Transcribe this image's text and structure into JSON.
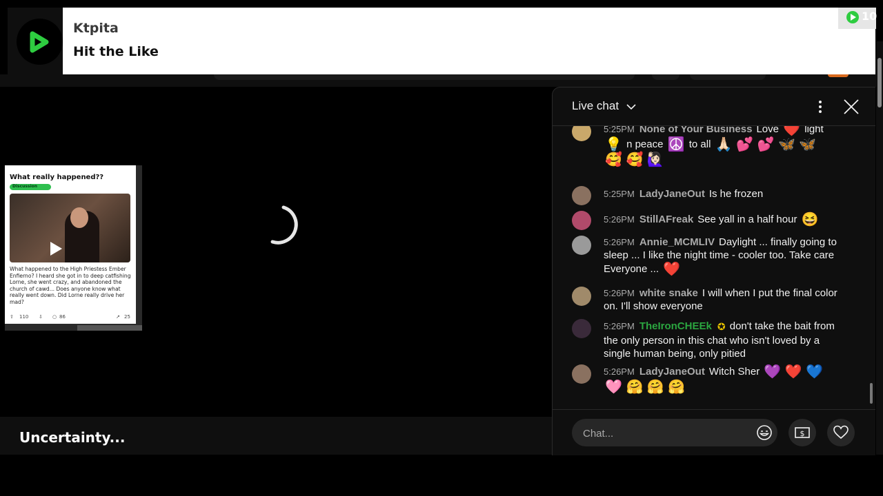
{
  "banner": {
    "title": "Ktpita",
    "subtitle": "Hit the Like",
    "corner_count": "10",
    "logo_icon": "play-logo-icon",
    "colors": {
      "accent": "#2ecc40"
    }
  },
  "player": {
    "post_card": {
      "title": "What really happened??",
      "tag": "Discussion",
      "body": "What happened to the High Priestess Ember Enfierno? I heard she got in to deep catfishing Lorne, she went crazy, and abandoned the church of cawd... Does anyone know what really went down. Did Lorne really drive her mad?",
      "upvotes": "110",
      "comments": "86",
      "shares": "25"
    }
  },
  "video": {
    "title": "Uncertainty..."
  },
  "chat": {
    "title": "Live chat",
    "input_placeholder": "Chat...",
    "messages": [
      {
        "time": "5:25PM",
        "author": "None of Your Business",
        "line1": "Love",
        "e1": "❤️",
        "line1b": "light",
        "line2a": "💡",
        "line2b": "n peace",
        "line2c": "☮️",
        "line2d": "to all",
        "line2e": "🙏🏻 💕 💕 🦋 🦋",
        "line3": "🥰 🥰 🙋🏻‍♀️"
      },
      {
        "time": "5:25PM",
        "author": "LadyJaneOut",
        "text": "Is he frozen"
      },
      {
        "time": "5:26PM",
        "author": "StillAFreak",
        "text": "See yall in a half hour",
        "emoji": "😆"
      },
      {
        "time": "5:26PM",
        "author": "Annie_MCMLIV",
        "text": "Daylight ... finally going to sleep ... I like the night time - cooler too. Take care Everyone ...",
        "emoji": "❤️"
      },
      {
        "time": "5:26PM",
        "author": "white snake",
        "text": "I will when I put the final color on. I'll show everyone"
      },
      {
        "time": "5:26PM",
        "author": "TheIronCHEEk",
        "text": "don't take the bait from the only person in this chat who isn't loved by a single human being, only pitied"
      },
      {
        "time": "5:26PM",
        "author": "LadyJaneOut",
        "text": "Witch Sher",
        "emoji": "💜 ❤️ 💙",
        "line2": "🩷 🤗 🤗 🤗"
      }
    ]
  }
}
